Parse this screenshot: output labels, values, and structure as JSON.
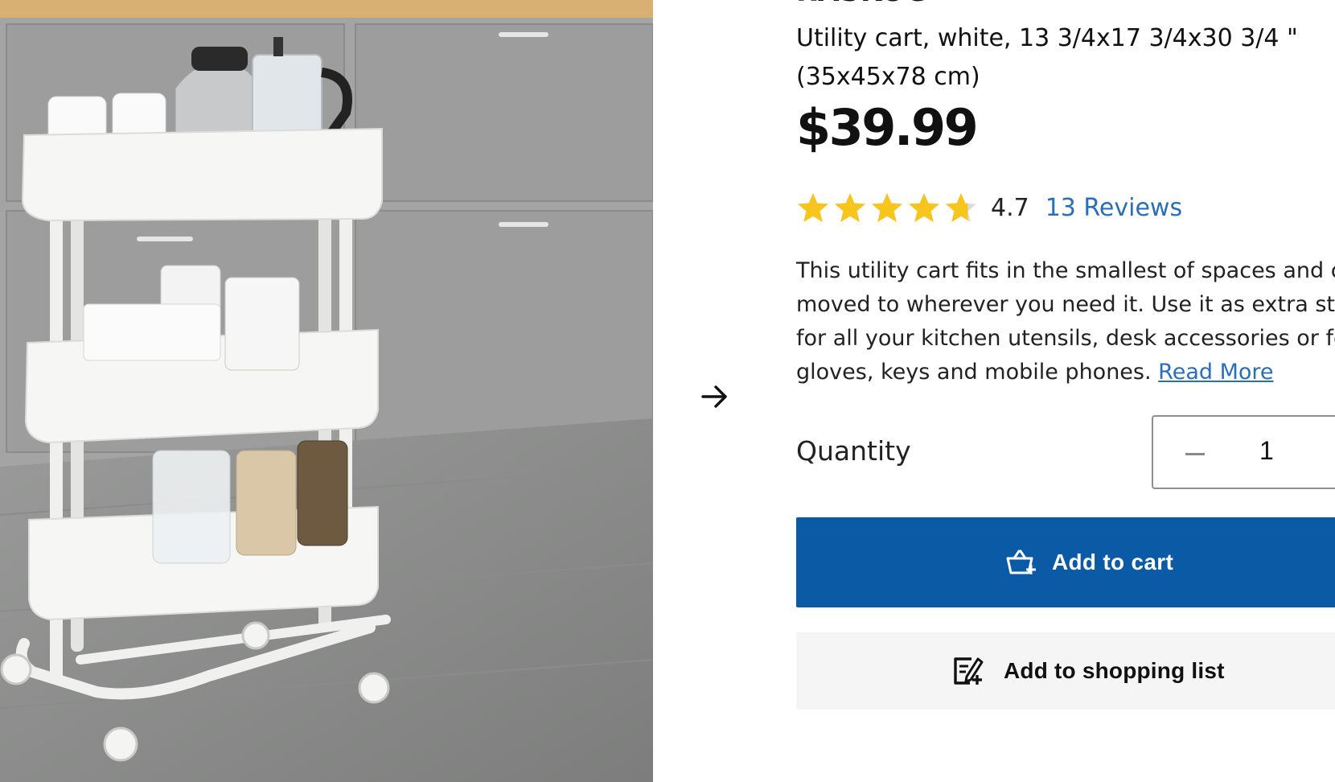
{
  "product": {
    "name": "RÅSKOG",
    "description": "Utility cart, white, 13 3/4x17 3/4x30 3/4 \" (35x45x78 cm)",
    "price": "$39.99",
    "image_alt": "White three-tier utility cart in a kitchen"
  },
  "rating": {
    "value": "4.7",
    "stars": 4.7,
    "reviews_label": "13 Reviews",
    "star_color": "#f7c51b",
    "empty_star_color": "#dcdcdc"
  },
  "summary": {
    "line1": "This utility cart fits in the smallest of spaces and can be",
    "line2": "moved to wherever you need it. Use it as extra storage",
    "line3": "for all your kitchen utensils, desk accessories or for",
    "line4": "gloves, keys and mobile phones.",
    "read_more": "Read More"
  },
  "quantity": {
    "label": "Quantity",
    "value": "1"
  },
  "buttons": {
    "add_to_cart": "Add to cart",
    "add_to_list": "Add to shopping list"
  },
  "carousel": {
    "next_icon": "arrow-right-icon"
  },
  "colors": {
    "primary_button": "#0b5aa6",
    "link": "#2a6fb5",
    "secondary_button_bg": "#f5f5f5"
  }
}
